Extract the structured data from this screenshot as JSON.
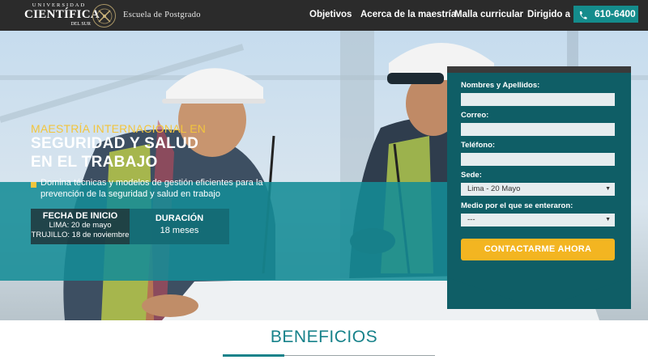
{
  "header": {
    "logo_line1": "UNIVERSIDAD",
    "logo_line2": "CIENTÍFICA",
    "logo_line3": "DEL SUR",
    "school": "Escuela de Postgrado",
    "nav": [
      {
        "label": "Objetivos"
      },
      {
        "label": "Acerca de la maestría"
      },
      {
        "label": "Malla curricular"
      },
      {
        "label": "Dirigido a"
      }
    ],
    "phone": "610-6400"
  },
  "hero": {
    "title_line1": "MAESTRÍA INTERNACIONAL EN",
    "title_line2": "SEGURIDAD Y SALUD",
    "title_line3": "EN EL TRABAJO",
    "description": "Domina técnicas y modelos de gestión eficientes para la prevención de la seguridad y salud en trabajo",
    "fecha_title": "FECHA DE INICIO",
    "fecha_lima": "LIMA: 20 de mayo",
    "fecha_trujillo": "TRUJILLO: 18 de noviembre",
    "duracion_title": "DURACIÓN",
    "duracion_value": "18 meses"
  },
  "form": {
    "name_label": "Nombres y Apellidos:",
    "email_label": "Correo:",
    "phone_label": "Teléfono:",
    "sede_label": "Sede:",
    "sede_value": "Lima - 20 Mayo",
    "medio_label": "Medio por el que se enteraron:",
    "medio_value": "---",
    "submit": "CONTACTARME AHORA"
  },
  "section": {
    "title": "BENEFICIOS"
  },
  "colors": {
    "teal": "#148c8c",
    "dark_teal": "#0f5e66",
    "yellow": "#f3b521",
    "header_bg": "#2b2b2b"
  }
}
